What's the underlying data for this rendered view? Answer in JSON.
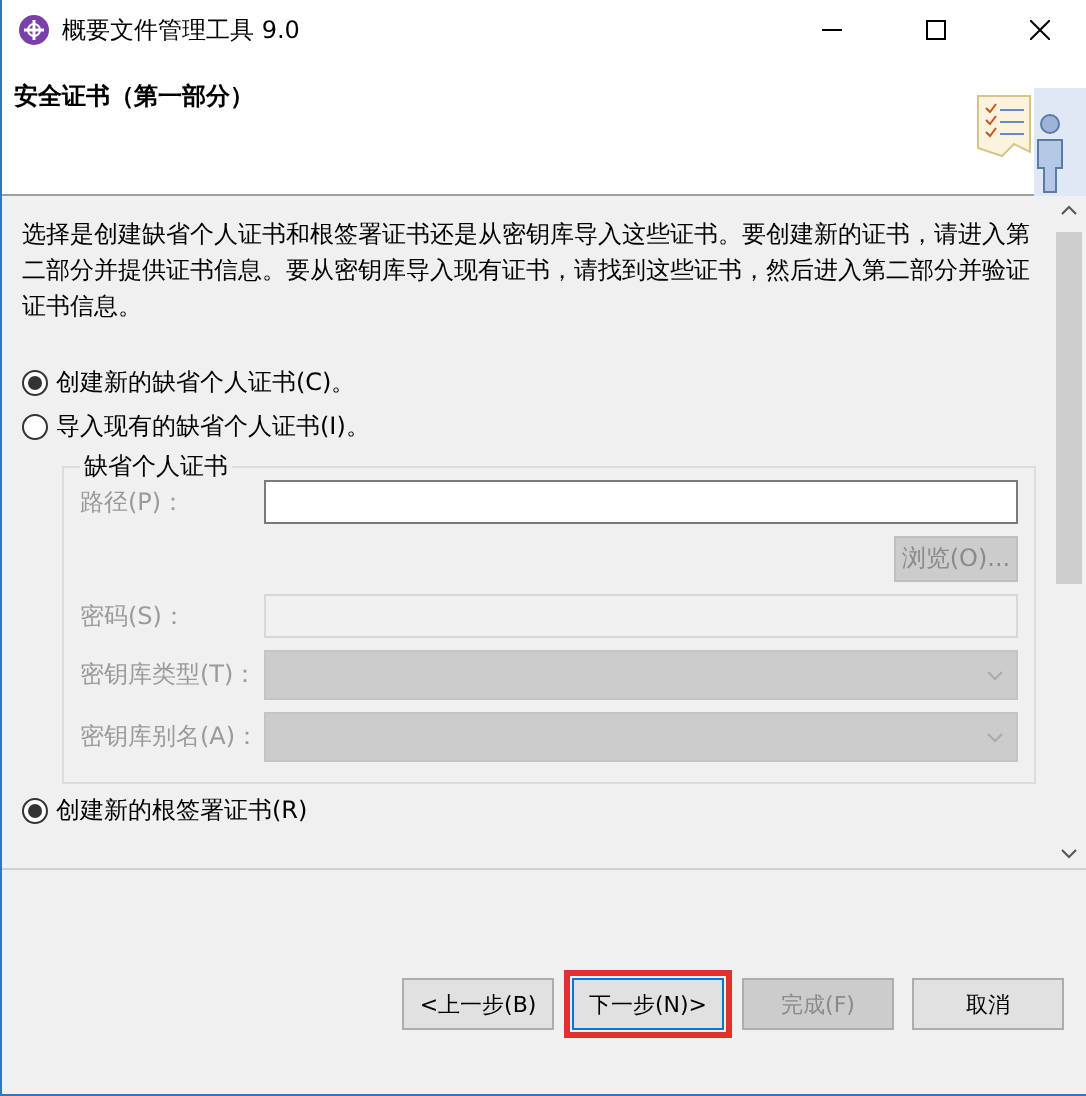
{
  "window": {
    "title": "概要文件管理工具 9.0"
  },
  "header": {
    "title": "安全证书（第一部分）"
  },
  "description": "选择是创建缺省个人证书和根签署证书还是从密钥库导入这些证书。要创建新的证书，请进入第二部分并提供证书信息。要从密钥库导入现有证书，请找到这些证书，然后进入第二部分并验证证书信息。",
  "personal_options": [
    {
      "label": "创建新的缺省个人证书(C)。",
      "selected": true
    },
    {
      "label": "导入现有的缺省个人证书(I)。",
      "selected": false
    }
  ],
  "group": {
    "title": "缺省个人证书",
    "path": {
      "label": "路径(P)：",
      "disabled": false
    },
    "browse_button": {
      "label": "浏览(O)...",
      "disabled": true
    },
    "password": {
      "label": "密码(S)：",
      "disabled": true
    },
    "keystore_type": {
      "label": "密钥库类型(T)：",
      "disabled": true
    },
    "keystore_alias": {
      "label": "密钥库别名(A)：",
      "disabled": true
    }
  },
  "root_option": {
    "label": "创建新的根签署证书(R)",
    "selected": true
  },
  "buttons": [
    {
      "label": "<上一步(B)",
      "disabled": false,
      "highlighted": false
    },
    {
      "label": "下一步(N)>",
      "disabled": false,
      "highlighted": true
    },
    {
      "label": "完成(F)",
      "disabled": true,
      "highlighted": false
    },
    {
      "label": "取消",
      "disabled": false,
      "highlighted": false
    }
  ]
}
